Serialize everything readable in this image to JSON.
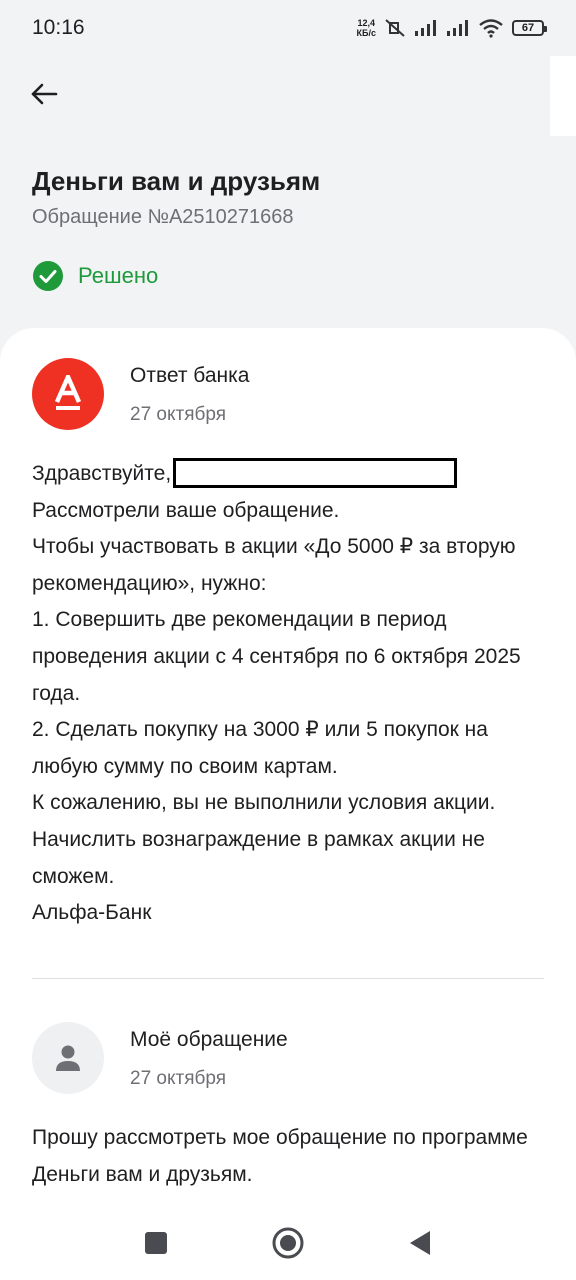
{
  "status_bar": {
    "time": "10:16",
    "net_speed_value": "12,4",
    "net_speed_unit": "КБ/с",
    "battery": "67"
  },
  "header": {
    "title": "Деньги вам и друзьям",
    "subtitle": "Обращение №A2510271668",
    "status_label": "Решено"
  },
  "messages": [
    {
      "author": "Ответ банка",
      "date": "27 октября",
      "avatar_icon": "alfa-bank-logo",
      "lines": [
        "Здравствуйте,",
        "Рассмотрели ваше обращение.",
        "Чтобы участвовать в акции «До 5000 ₽ за вторую рекомендацию», нужно:",
        "1. Совершить две рекомендации в период проведения акции с 4 сентября по 6 октября 2025 года.",
        "2. Сделать покупку на 3000 ₽ или 5 покупок на любую сумму по своим картам.",
        "К сожалению, вы не выполнили условия акции. Начислить вознаграждение в рамках акции не сможем.",
        "Альфа-Банк"
      ]
    },
    {
      "author": "Моё обращение",
      "date": "27 октября",
      "avatar_icon": "user-icon",
      "lines": [
        "Прошу рассмотреть мое обращение по программе Деньги вам и друзьям."
      ]
    }
  ],
  "colors": {
    "accent_red": "#ef3124",
    "success_green": "#1e9a3a",
    "background": "#f2f3f5"
  }
}
